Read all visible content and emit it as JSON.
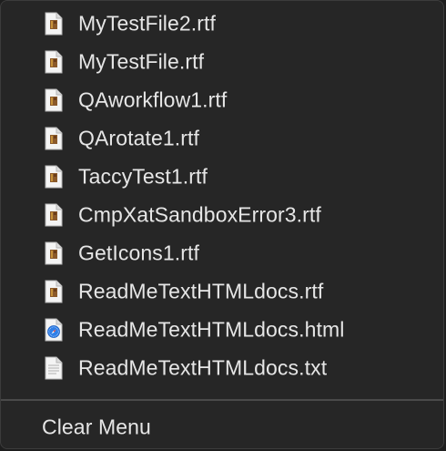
{
  "recent_files": [
    {
      "label": "MyTestFile2.rtf",
      "icon": "rtf-document-icon"
    },
    {
      "label": "MyTestFile.rtf",
      "icon": "rtf-document-icon"
    },
    {
      "label": "QAworkflow1.rtf",
      "icon": "rtf-document-icon"
    },
    {
      "label": "QArotate1.rtf",
      "icon": "rtf-document-icon"
    },
    {
      "label": "TaccyTest1.rtf",
      "icon": "rtf-document-icon"
    },
    {
      "label": "CmpXatSandboxError3.rtf",
      "icon": "rtf-document-icon"
    },
    {
      "label": "GetIcons1.rtf",
      "icon": "rtf-document-icon"
    },
    {
      "label": "ReadMeTextHTMLdocs.rtf",
      "icon": "rtf-document-icon"
    },
    {
      "label": "ReadMeTextHTMLdocs.html",
      "icon": "safari-html-document-icon"
    },
    {
      "label": "ReadMeTextHTMLdocs.txt",
      "icon": "text-document-icon"
    }
  ],
  "clear_menu_label": "Clear Menu",
  "colors": {
    "menu_background": "#262626",
    "text": "#e6e6e6",
    "separator": "#4a4a4a",
    "html_icon_accent": "#2f7fe8"
  }
}
